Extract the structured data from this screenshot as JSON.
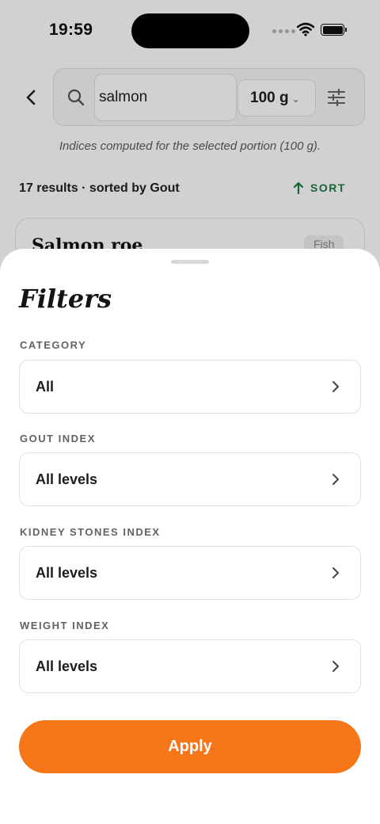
{
  "status": {
    "time": "19:59"
  },
  "search": {
    "query": "salmon",
    "portion": "100 g"
  },
  "portion_note": "Indices computed for the selected portion (100 g).",
  "results": {
    "summary": "17 results · sorted by Gout",
    "sort_label": "SORT"
  },
  "card": {
    "title": "Salmon roe",
    "category": "Fish"
  },
  "sheet": {
    "title": "Filters",
    "filters": [
      {
        "label": "CATEGORY",
        "value": "All"
      },
      {
        "label": "GOUT INDEX",
        "value": "All levels"
      },
      {
        "label": "KIDNEY STONES INDEX",
        "value": "All levels"
      },
      {
        "label": "WEIGHT INDEX",
        "value": "All levels"
      }
    ],
    "apply_label": "Apply"
  },
  "colors": {
    "accent": "#f7761a",
    "sort_green": "#1e7a45"
  },
  "icons": [
    "back-arrow-icon",
    "search-icon",
    "tune-icon",
    "arrow-up-icon",
    "chevron-right-icon",
    "wifi-icon",
    "battery-icon"
  ]
}
